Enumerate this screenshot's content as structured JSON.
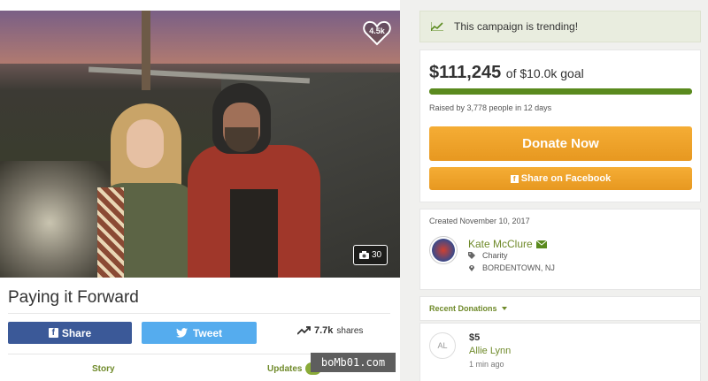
{
  "campaign": {
    "title": "Paying it Forward",
    "likes": "4.5k",
    "photo_count": "30"
  },
  "share": {
    "facebook_label": "Share",
    "twitter_label": "Tweet",
    "shares_count": "7.7k",
    "shares_label": "shares"
  },
  "tabs": {
    "story": "Story",
    "updates": "Updates",
    "updates_count": "8"
  },
  "watermark": "boMb01.com",
  "trending": {
    "text": "This campaign is trending!"
  },
  "funding": {
    "raised": "$111,245",
    "goal_text": "of $10.0k goal",
    "progress_percent": 100,
    "raised_by": "Raised by 3,778 people in 12 days",
    "donate_label": "Donate Now",
    "fb_share_label": "Share on Facebook"
  },
  "organizer": {
    "created": "Created November 10, 2017",
    "name": "Kate McClure",
    "category": "Charity",
    "location": "BORDENTOWN, NJ"
  },
  "recent": {
    "header": "Recent Donations",
    "donations": [
      {
        "initials": "AL",
        "amount": "$5",
        "name": "Allie Lynn",
        "time": "1 min ago"
      }
    ]
  },
  "colors": {
    "accent_green": "#6f8a2a",
    "progress": "#5a8a1e",
    "donate_orange": "#eea12a",
    "facebook_blue": "#3b5998",
    "twitter_blue": "#55acee"
  }
}
